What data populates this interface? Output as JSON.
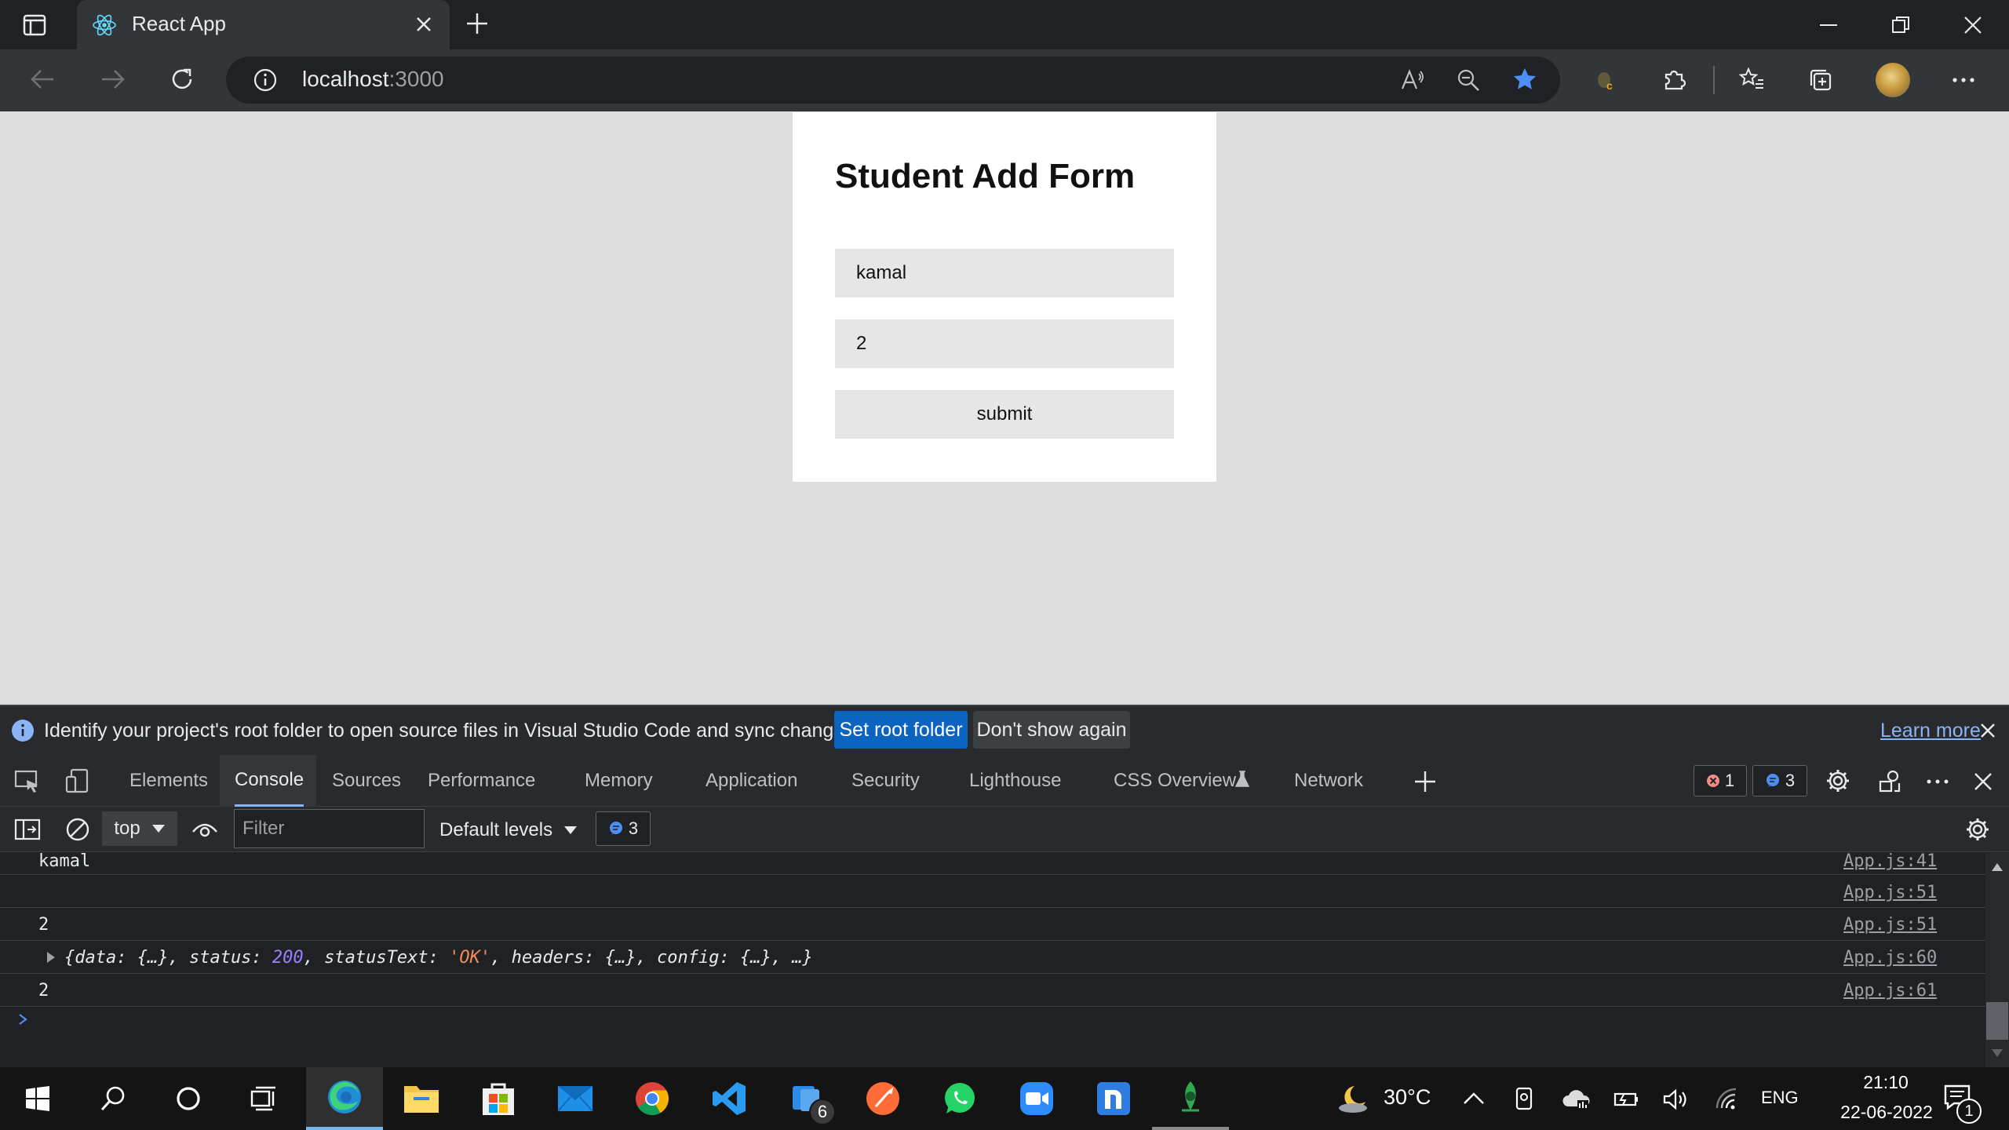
{
  "browser": {
    "tab_title": "React App",
    "url_host": "localhost",
    "url_port": ":3000"
  },
  "page": {
    "form_title": "Student Add Form",
    "name_value": "kamal",
    "age_value": "2",
    "submit_label": "submit"
  },
  "devtools": {
    "infobar": {
      "message": "Identify your project's root folder to open source files in Visual Studio Code and sync changes.",
      "set_root_label": "Set root folder",
      "dont_show_label": "Don't show again",
      "learn_more_label": "Learn more"
    },
    "tabs": [
      "Elements",
      "Console",
      "Sources",
      "Performance",
      "Memory",
      "Application",
      "Security",
      "Lighthouse",
      "CSS Overview",
      "Network"
    ],
    "error_count": "1",
    "message_count": "3",
    "console": {
      "context": "top",
      "filter_placeholder": "Filter",
      "levels_label": "Default levels",
      "messages_badge": "3",
      "messages": [
        {
          "text": "kamal",
          "source": "App.js:41"
        },
        {
          "text": "",
          "source": "App.js:51"
        },
        {
          "text": "2",
          "source": "App.js:51"
        },
        {
          "source": "App.js:60",
          "obj_open": "{data: ",
          "obj_data": "{…}",
          "obj_status_key": ", status: ",
          "obj_status": "200",
          "obj_statustext_key": ", statusText: ",
          "obj_statustext": "'OK'",
          "obj_rest": ", headers: {…}, config: {…}, …}"
        },
        {
          "text": "2",
          "source": "App.js:61"
        }
      ]
    }
  },
  "taskbar": {
    "temperature": "30°C",
    "language": "ENG",
    "time": "21:10",
    "date": "22-06-2022",
    "teams_badge": "6",
    "notification_count": "1"
  },
  "colors": {
    "accent_blue": "#0b64c0",
    "link_blue": "#8ab4f8",
    "error_red": "#f28b82",
    "page_bg": "#dcdcdc"
  }
}
